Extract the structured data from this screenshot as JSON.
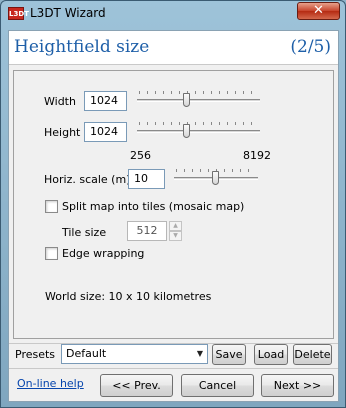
{
  "window": {
    "title": "L3DT Wizard",
    "app_icon_text": "L3DT",
    "close_glyph": "✕"
  },
  "header": {
    "title": "Heightfield size",
    "step": "(2/5)"
  },
  "form": {
    "width_label": "Width",
    "width_value": "1024",
    "height_label": "Height",
    "height_value": "1024",
    "size_slider": {
      "min_label": "256",
      "max_label": "8192",
      "level_fraction": 0.4
    },
    "horiz_scale_label": "Horiz. scale (m)",
    "horiz_scale_value": "10",
    "horiz_scale_level_fraction": 0.48,
    "split_tiles_label": "Split map into tiles (mosaic map)",
    "split_tiles_checked": false,
    "tile_size_label": "Tile size",
    "tile_size_value": "512",
    "edge_wrapping_label": "Edge wrapping",
    "edge_wrapping_checked": false,
    "world_size_text": "World size: 10 x 10 kilometres"
  },
  "presets": {
    "label": "Presets",
    "selected": "Default",
    "save_label": "Save",
    "load_label": "Load",
    "delete_label": "Delete"
  },
  "footer": {
    "help_link": "On-line help",
    "prev_label": "<< Prev.",
    "cancel_label": "Cancel",
    "next_label": "Next >>"
  },
  "icons": {
    "close": "close-icon",
    "dropdown": "chevron-down-icon",
    "spin_up": "spin-up-icon",
    "spin_down": "spin-down-icon"
  },
  "colors": {
    "header_text": "#1e5fa8",
    "titlebar": "#9ec3d9",
    "close_button": "#c7432b",
    "link": "#0645ad"
  }
}
